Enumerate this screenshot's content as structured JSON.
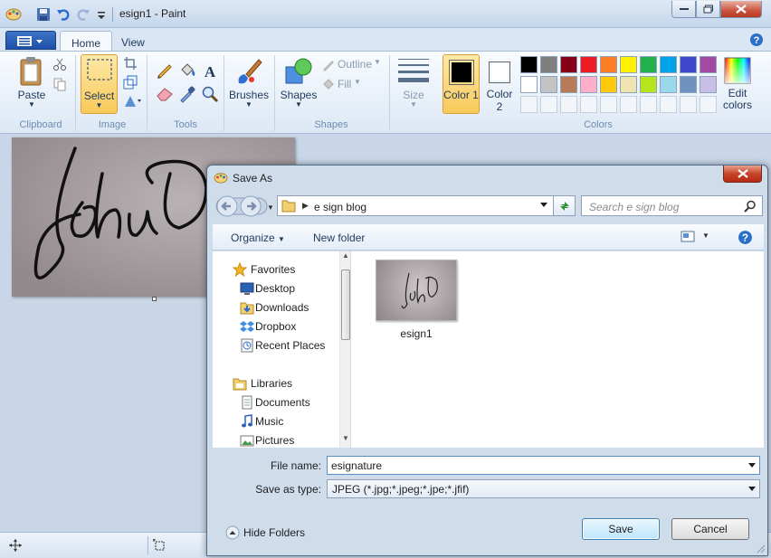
{
  "window": {
    "title": "esign1 - Paint"
  },
  "tabs": [
    {
      "label": "Home"
    },
    {
      "label": "View"
    }
  ],
  "ribbon": {
    "clipboard": {
      "paste": "Paste",
      "group": "Clipboard"
    },
    "image": {
      "select": "Select",
      "group": "Image"
    },
    "tools": {
      "group": "Tools"
    },
    "brushes": {
      "label": "Brushes"
    },
    "shapes": {
      "label": "Shapes",
      "outline": "Outline",
      "fill": "Fill",
      "group": "Shapes"
    },
    "size": {
      "label": "Size"
    },
    "colors": {
      "color1": "Color 1",
      "color2": "Color 2",
      "edit": "Edit colors",
      "group": "Colors",
      "color1_value": "#000000",
      "color2_value": "#ffffff",
      "palette_row1": [
        "#000000",
        "#7f7f7f",
        "#880015",
        "#ed1c24",
        "#ff7f27",
        "#fff200",
        "#22b14c",
        "#00a2e8",
        "#3f48cc",
        "#a349a4"
      ],
      "palette_row2": [
        "#ffffff",
        "#c3c3c3",
        "#b97a57",
        "#ffaec9",
        "#ffc90e",
        "#efe4b0",
        "#b5e61d",
        "#99d9ea",
        "#7092be",
        "#c8bfe7"
      ]
    }
  },
  "dialog": {
    "title": "Save As",
    "address": "e sign blog",
    "search_placeholder": "Search e sign blog",
    "toolbar": {
      "organize": "Organize",
      "new_folder": "New folder"
    },
    "nav": {
      "favorites": "Favorites",
      "favorite_items": [
        "Desktop",
        "Downloads",
        "Dropbox",
        "Recent Places"
      ],
      "libraries": "Libraries",
      "library_items": [
        "Documents",
        "Music",
        "Pictures"
      ]
    },
    "files": [
      {
        "name": "esign1"
      }
    ],
    "file_name_label": "File name:",
    "file_name_value": "esignature",
    "save_type_label": "Save as type:",
    "save_type_value": "JPEG (*.jpg;*.jpeg;*.jpe;*.jfif)",
    "hide_folders": "Hide Folders",
    "save": "Save",
    "cancel": "Cancel"
  }
}
